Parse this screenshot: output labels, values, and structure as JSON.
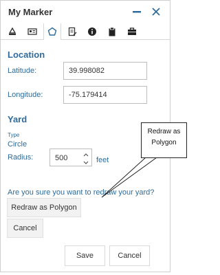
{
  "window": {
    "title": "My Marker"
  },
  "tabs": [
    {
      "icon": "ruler-icon"
    },
    {
      "icon": "id-card-icon"
    },
    {
      "icon": "pentagon-icon",
      "active": true
    },
    {
      "icon": "document-edit-icon"
    },
    {
      "icon": "info-icon"
    },
    {
      "icon": "clipboard-icon"
    },
    {
      "icon": "briefcase-icon"
    }
  ],
  "location": {
    "heading": "Location",
    "latitude_label": "Latitude:",
    "latitude_value": "39.998082",
    "longitude_label": "Longitude:",
    "longitude_value": "-75.179414"
  },
  "yard": {
    "heading": "Yard",
    "type_label": "Type",
    "type_value": "Circle",
    "radius_label": "Radius:",
    "radius_value": "500",
    "radius_units": "feet"
  },
  "confirm": {
    "question": "Are you sure you want to redraw your yard?",
    "redraw_label": "Redraw as Polygon",
    "cancel_label": "Cancel"
  },
  "footer": {
    "save_label": "Save",
    "cancel_label": "Cancel"
  },
  "callout": {
    "line1": "Redraw as",
    "line2": "Polygon"
  },
  "colors": {
    "label_blue": "#2e6b9c",
    "tab_icon": "#333333",
    "active_tab_icon": "#2e6b9c"
  }
}
